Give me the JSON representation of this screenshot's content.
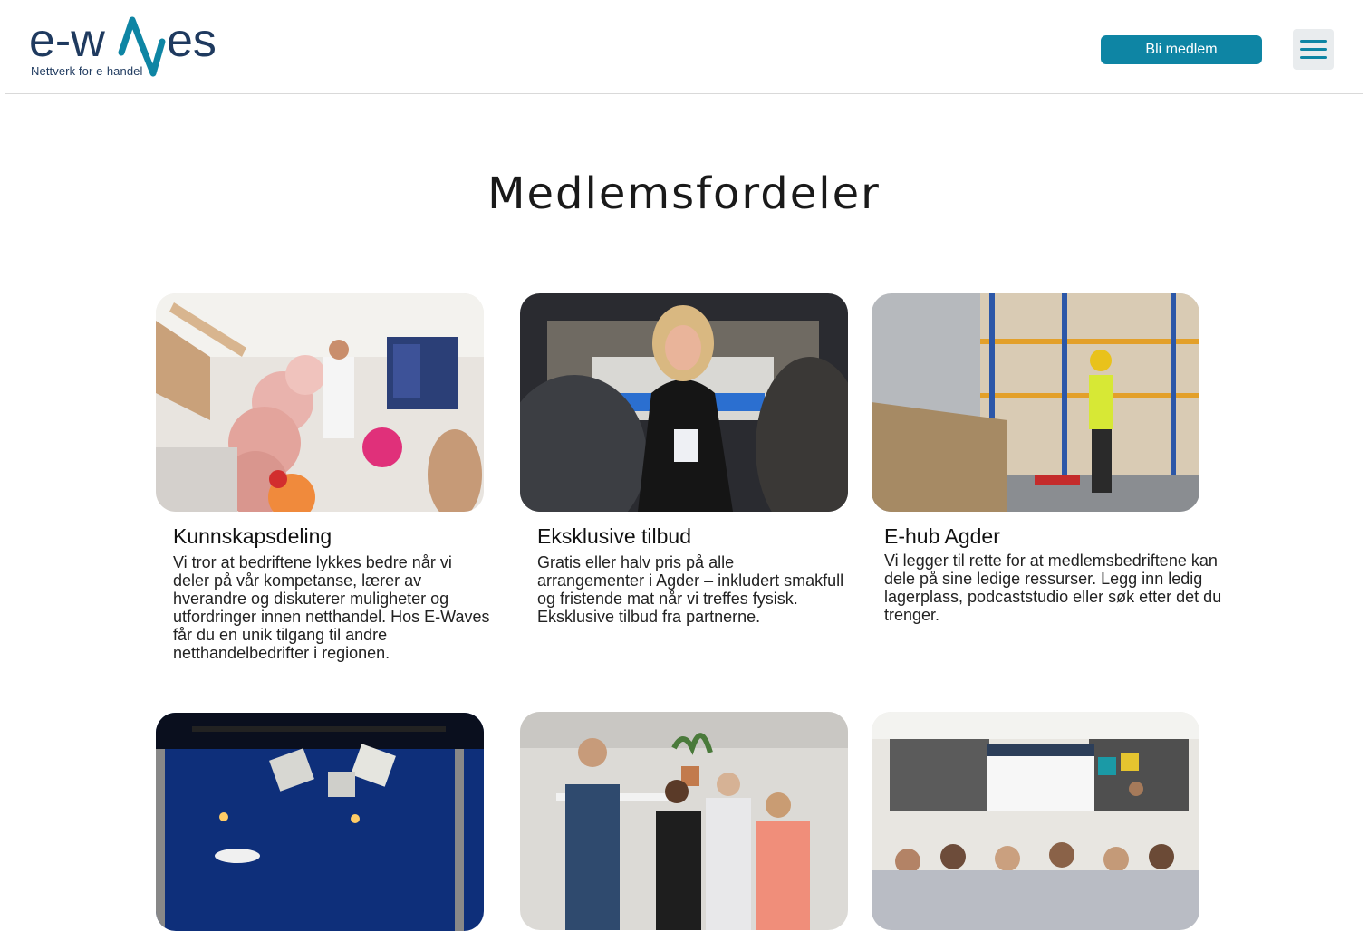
{
  "header": {
    "logo_text": "e-waves",
    "logo_tagline": "Nettverk for e-handel",
    "join_label": "Bli medlem",
    "menu_icon": "hamburger-menu-icon"
  },
  "colors": {
    "accent": "#0e85a4",
    "logo_navy": "#1f3a5f",
    "menu_bg": "#e9ecee"
  },
  "main": {
    "title": "Medlemsfordeler",
    "cards": [
      {
        "title": "Kunnskapsdeling",
        "text": "Vi tror at bedriftene lykkes bedre når vi deler på vår kompetanse, lærer av hverandre og diskuterer muligheter og utfordringer innen netthandel. Hos E-Waves får du en unik tilgang til andre netthandelbedrifter i regionen.",
        "image": "conference-speaker-photo"
      },
      {
        "title": "Eksklusive tilbud",
        "text": "Gratis eller halv pris på alle arrangementer i Agder – inkludert smakfull og fristende mat når vi treffes fysisk. Eksklusive tilbud fra partnerne.",
        "image": "event-host-photo"
      },
      {
        "title": "E-hub Agder",
        "text": "Vi legger til rette for at medlemsbedriftene kan dele på sine ledige ressurser. Legg inn ledig lagerplass, podcaststudio eller søk etter det du trenger.",
        "image": "warehouse-photo"
      },
      {
        "image": "stage-lights-photo"
      },
      {
        "image": "networking-group-photo"
      },
      {
        "image": "seminar-audience-photo"
      }
    ]
  }
}
